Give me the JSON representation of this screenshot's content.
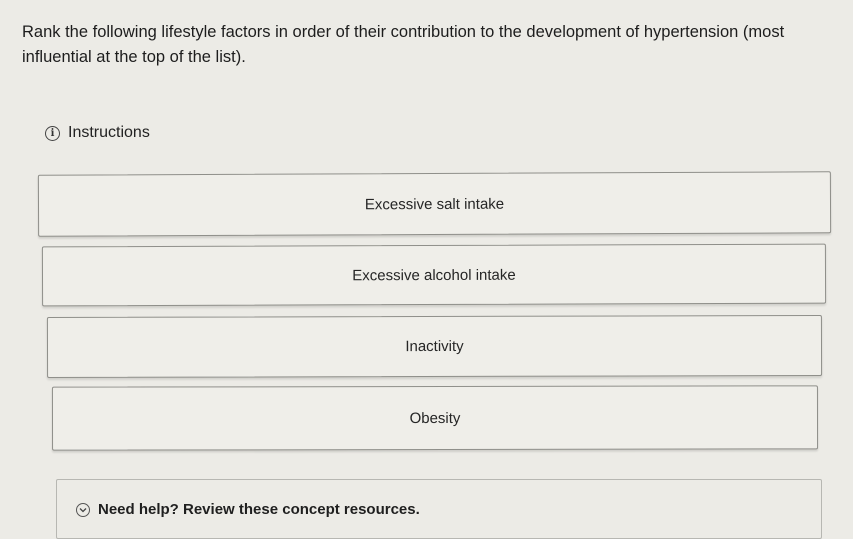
{
  "question": {
    "text": "Rank the following lifestyle factors in order of their contribution to the development of hypertension (most influential at the top of the list)."
  },
  "instructions": {
    "icon": "info-icon",
    "label": "Instructions"
  },
  "rank_items": [
    {
      "label": "Excessive salt intake"
    },
    {
      "label": "Excessive alcohol intake"
    },
    {
      "label": "Inactivity"
    },
    {
      "label": "Obesity"
    }
  ],
  "help": {
    "icon": "chevron-down-circle-icon",
    "label": "Need help? Review these concept resources."
  }
}
